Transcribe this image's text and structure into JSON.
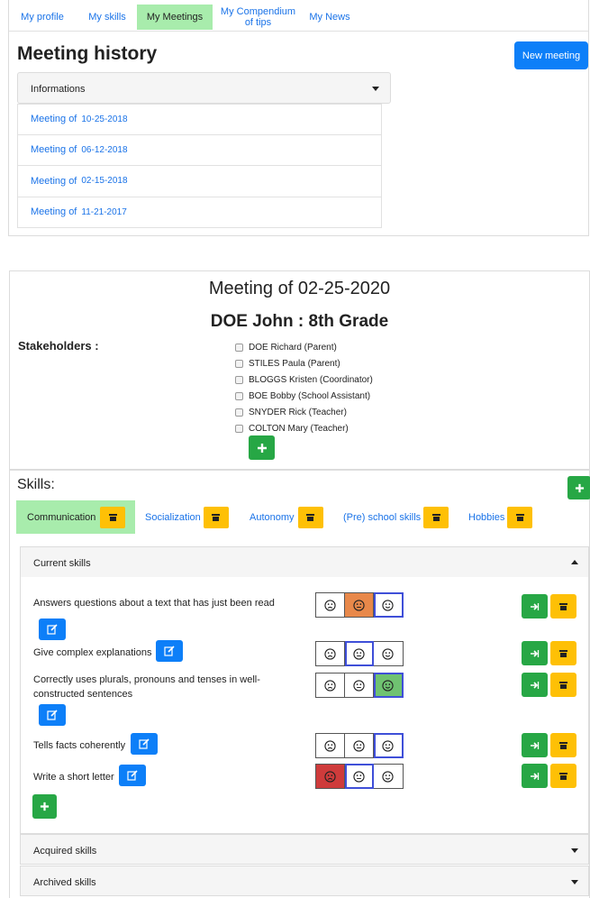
{
  "nav": {
    "tabs": [
      {
        "label": "My profile"
      },
      {
        "label": "My skills"
      },
      {
        "label": "My Meetings"
      },
      {
        "label": "My Compendium of tips"
      },
      {
        "label": "My News"
      }
    ],
    "active_tab": "My Meetings"
  },
  "history": {
    "title": "Meeting history",
    "new_meeting_label": "New meeting",
    "info_dropdown": "Informations",
    "meeting_prefix": "Meeting of",
    "meetings": [
      {
        "date": "10-25-2018"
      },
      {
        "date": "06-12-2018"
      },
      {
        "date": "02-15-2018"
      },
      {
        "date": "11-21-2017"
      }
    ]
  },
  "meeting": {
    "title": "Meeting of 02-25-2020",
    "student": "DOE John :  8th Grade",
    "stakeholders_label": "Stakeholders :",
    "stakeholders": [
      {
        "name": "DOE Richard (Parent)"
      },
      {
        "name": "STILES Paula (Parent)"
      },
      {
        "name": "BLOGGS Kristen (Coordinator)"
      },
      {
        "name": "BOE Bobby (School Assistant)"
      },
      {
        "name": "SNYDER Rick (Teacher)"
      },
      {
        "name": "COLTON Mary (Teacher)"
      }
    ],
    "add_icon": "plus-icon"
  },
  "skills": {
    "label": "Skills:",
    "categories": [
      {
        "label": "Communication"
      },
      {
        "label": "Socialization"
      },
      {
        "label": "Autonomy"
      },
      {
        "label": "(Pre) school skills"
      },
      {
        "label": "Hobbies"
      }
    ],
    "active_category": "Communication",
    "sections": {
      "current": "Current skills",
      "acquired": "Acquired skills",
      "archived": "Archived skills"
    },
    "current_skills": [
      {
        "text": "Answers questions about a text that has just been read",
        "rating": "neutral"
      },
      {
        "text": "Give complex explanations",
        "rating": "neutral"
      },
      {
        "text": "Correctly uses plurals, pronouns and tenses in well-constructed sentences",
        "rating": "happy"
      },
      {
        "text": "Tells facts coherently",
        "rating": "happy"
      },
      {
        "text": "Write a short letter",
        "rating": "sad"
      }
    ],
    "rating_faces": [
      "sad-face-icon",
      "neutral-face-icon",
      "happy-face-icon"
    ],
    "colors": {
      "orange": "#e8884a",
      "green": "#6fc271",
      "red": "#cf3b3b",
      "primary": "#0d7ff8",
      "success": "#27a745",
      "warning": "#fec006"
    }
  }
}
